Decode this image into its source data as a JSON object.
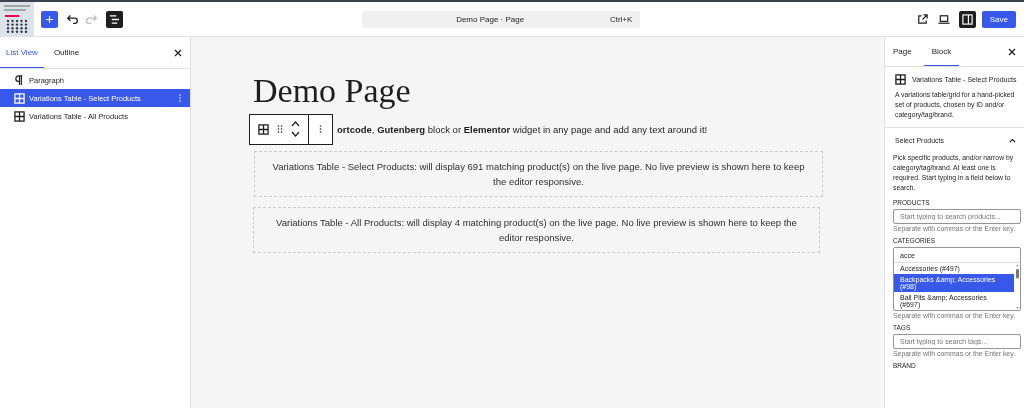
{
  "topbar": {
    "command": "Demo Page · Page",
    "shortcut": "Ctrl+K",
    "save": "Save",
    "list_view_open": true,
    "settings_open": true
  },
  "list_view": {
    "tabs": [
      {
        "label": "List View",
        "selected": true
      },
      {
        "label": "Outline",
        "selected": false
      }
    ],
    "items": [
      {
        "kind": "paragraph",
        "label": "Paragraph",
        "selected": false
      },
      {
        "kind": "table",
        "label": "Variations Table - Select Products",
        "selected": true
      },
      {
        "kind": "table",
        "label": "Variations Table - All Products",
        "selected": false
      }
    ]
  },
  "canvas": {
    "title": "Demo Page",
    "paragraph": "**ortcode**, **Gutenberg** block or **Elementor** widget in any page and add any text around it!",
    "blocks": [
      {
        "text": "Variations Table - Select Products: will display 691 matching product(s) on the live page. No live preview is shown here to keep the editor responsive."
      },
      {
        "text": "Variations Table - All Products: will display 4 matching product(s) on the live page. No live preview is shown here to keep the editor responsive."
      }
    ]
  },
  "inspector": {
    "tabs": [
      {
        "label": "Page",
        "selected": false
      },
      {
        "label": "Block",
        "selected": true
      }
    ],
    "block_title": "Variations Table - Select Products",
    "block_description": "A variations table/grid for a hand-picked set of products, chosen by ID and/or category/tag/brand.",
    "panel": {
      "title": "Select Products",
      "expanded": true,
      "description": "Pick specific products, and/or narrow by category/tag/brand. At least one is required. Start typing in a field below to search.",
      "fields": [
        {
          "label": "PRODUCTS",
          "placeholder": "Start typing to search products...",
          "help": "Separate with commas or the Enter key."
        },
        {
          "label": "CATEGORIES",
          "value": "acce",
          "suggestions": [
            {
              "label": "Accessories (#497)",
              "selected": false
            },
            {
              "label": "Backpacks &amp; Accessories (#98)",
              "selected": true
            },
            {
              "label": "Ball Pits &amp; Accessories (#697)",
              "selected": false
            }
          ],
          "help": "Separate with commas or the Enter key."
        },
        {
          "label": "TAGS",
          "placeholder": "Start typing to search tags...",
          "help": "Separate with commas or the Enter key."
        },
        {
          "label": "BRAND"
        }
      ]
    }
  }
}
